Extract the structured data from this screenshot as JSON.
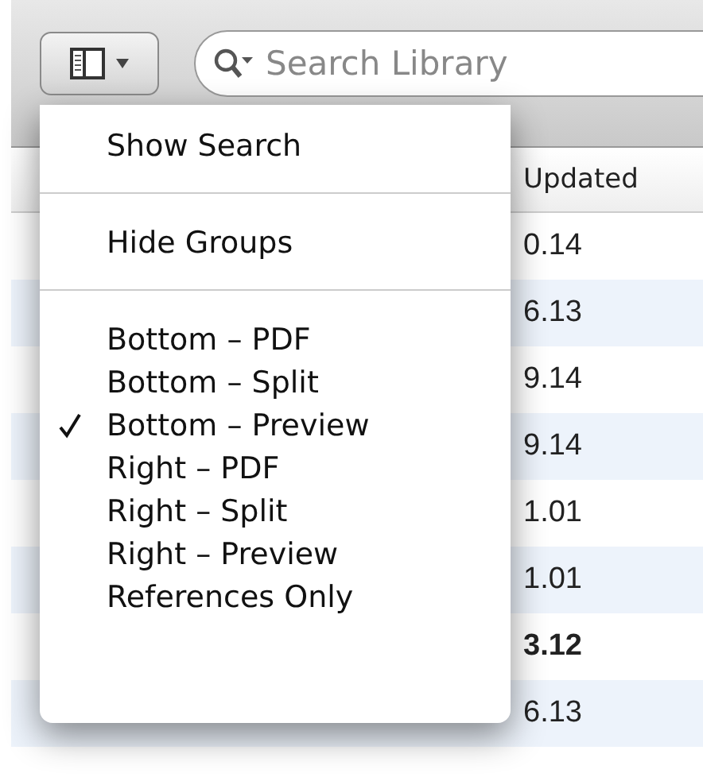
{
  "toolbar": {
    "view_button": {
      "has_menu": true
    },
    "search": {
      "placeholder": "Search Library"
    }
  },
  "table": {
    "columns": [
      {
        "label": "Updated"
      }
    ],
    "rows": [
      {
        "updated": "0.14",
        "unread": false
      },
      {
        "updated": "6.13",
        "unread": false
      },
      {
        "updated": "9.14",
        "unread": false
      },
      {
        "updated": "9.14",
        "unread": false
      },
      {
        "updated": "1.01",
        "unread": false
      },
      {
        "updated": "1.01",
        "unread": false
      },
      {
        "updated": "3.12",
        "unread": true
      },
      {
        "updated": "6.13",
        "unread": false
      }
    ]
  },
  "menu": {
    "items": [
      {
        "kind": "item",
        "label": "Show Search",
        "checked": false
      },
      {
        "kind": "separator"
      },
      {
        "kind": "item",
        "label": "Hide Groups",
        "checked": false
      },
      {
        "kind": "separator"
      },
      {
        "kind": "item",
        "label": "Bottom – PDF",
        "checked": false
      },
      {
        "kind": "item",
        "label": "Bottom – Split",
        "checked": false
      },
      {
        "kind": "item",
        "label": "Bottom – Preview",
        "checked": true
      },
      {
        "kind": "item",
        "label": "Right – PDF",
        "checked": false
      },
      {
        "kind": "item",
        "label": "Right – Split",
        "checked": false
      },
      {
        "kind": "item",
        "label": "Right – Preview",
        "checked": false
      },
      {
        "kind": "item",
        "label": "References Only",
        "checked": false
      }
    ]
  }
}
